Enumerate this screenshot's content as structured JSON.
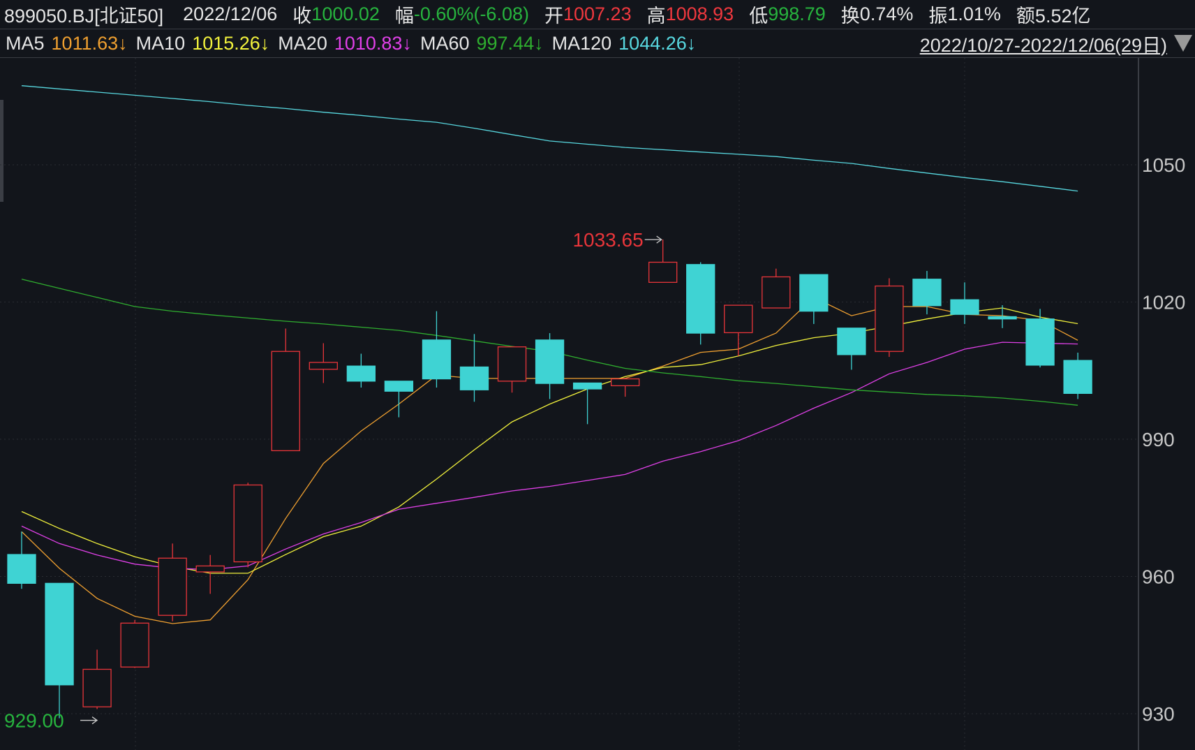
{
  "header": {
    "symbol": "899050.BJ[北证50]",
    "date": "2022/12/06",
    "close_label": "收",
    "close": "1000.02",
    "change_label": "幅",
    "change": "-0.60%(-6.08)",
    "open_label": "开",
    "open": "1007.23",
    "high_label": "高",
    "high": "1008.93",
    "low_label": "低",
    "low": "998.79",
    "turnover_label": "换",
    "turnover": "0.74%",
    "amplitude_label": "振",
    "amplitude": "1.01%",
    "amount_label": "额",
    "amount": "5.52亿"
  },
  "ma_bar": {
    "ma5_label": "MA5",
    "ma5": "1011.63↓",
    "ma10_label": "MA10",
    "ma10": "1015.26↓",
    "ma20_label": "MA20",
    "ma20": "1010.83↓",
    "ma60_label": "MA60",
    "ma60": "997.44↓",
    "ma120_label": "MA120",
    "ma120": "1044.26↓",
    "range": "2022/10/27-2022/12/06(29日)"
  },
  "colors": {
    "up": "#e8353a",
    "down": "#3fd3d3",
    "ma5": "#f0a030",
    "ma10": "#f2f23c",
    "ma20": "#e040e8",
    "ma60": "#2fae2f",
    "ma120": "#58d8e0",
    "axis": "#c8c8c8"
  },
  "chart_data": {
    "type": "candlestick",
    "ylim": [
      925,
      1080
    ],
    "yticks": [
      "1050",
      "1020",
      "990",
      "960",
      "930"
    ],
    "ytick_values": [
      1050,
      1020,
      990,
      960,
      930
    ],
    "annotations": {
      "max_label": "1033.65",
      "max_index": 17,
      "min_label": "929.00",
      "min_index": 1
    },
    "ohlc": [
      [
        964.8,
        969.8,
        957.3,
        958.5
      ],
      [
        958.5,
        958.5,
        929.0,
        936.3
      ],
      [
        931.5,
        944.0,
        931.0,
        939.7
      ],
      [
        940.2,
        950.5,
        940.0,
        949.8
      ],
      [
        951.5,
        967.2,
        950.2,
        964.0
      ],
      [
        961.0,
        964.7,
        956.2,
        962.3
      ],
      [
        963.2,
        980.5,
        962.0,
        980.0
      ],
      [
        987.5,
        1014.2,
        987.5,
        1009.2
      ],
      [
        1005.3,
        1011.0,
        1002.3,
        1006.8
      ],
      [
        1006.0,
        1008.7,
        1001.3,
        1002.7
      ],
      [
        1002.7,
        1002.7,
        994.8,
        1000.5
      ],
      [
        1011.7,
        1018.0,
        1001.3,
        1003.2
      ],
      [
        1005.8,
        1013.0,
        998.2,
        1000.8
      ],
      [
        1002.7,
        1010.2,
        1000.2,
        1010.2
      ],
      [
        1011.7,
        1013.2,
        998.8,
        1002.2
      ],
      [
        1002.3,
        1002.3,
        993.3,
        1001.0
      ],
      [
        1001.7,
        1003.2,
        999.3,
        1003.2
      ],
      [
        1024.3,
        1033.65,
        1024.3,
        1028.7
      ],
      [
        1028.2,
        1028.7,
        1010.7,
        1013.2
      ],
      [
        1013.3,
        1019.3,
        1008.2,
        1019.3
      ],
      [
        1018.7,
        1027.3,
        1018.7,
        1025.5
      ],
      [
        1026.0,
        1026.0,
        1015.2,
        1018.0
      ],
      [
        1014.3,
        1014.3,
        1005.2,
        1008.5
      ],
      [
        1009.2,
        1025.2,
        1008.0,
        1023.5
      ],
      [
        1025.0,
        1026.8,
        1017.3,
        1019.2
      ],
      [
        1020.5,
        1024.3,
        1015.2,
        1017.3
      ],
      [
        1016.8,
        1019.3,
        1014.3,
        1016.3
      ],
      [
        1016.3,
        1018.5,
        1005.7,
        1006.2
      ],
      [
        1007.23,
        1008.93,
        998.79,
        1000.02
      ]
    ],
    "series": [
      {
        "name": "MA5",
        "values": [
          969.8,
          961.8,
          955.2,
          951.3,
          949.7,
          950.5,
          959.3,
          972.7,
          984.7,
          991.8,
          997.7,
          1004,
          1003.3,
          1003.3,
          1003.3,
          1003.3,
          1003.3,
          1006,
          1009,
          1009.7,
          1013.2,
          1021,
          1017,
          1019,
          1019,
          1017.3,
          1017,
          1016,
          1011.63
        ]
      },
      {
        "name": "MA10",
        "values": [
          974.2,
          970.5,
          967.2,
          964.3,
          962.2,
          960.7,
          960.7,
          964.8,
          968.7,
          971,
          975.2,
          981.3,
          987.7,
          993.8,
          997.7,
          1001,
          1003.7,
          1005.7,
          1006.3,
          1008.2,
          1010.5,
          1012.2,
          1013.2,
          1014.7,
          1016.3,
          1017.7,
          1018.7,
          1016.7,
          1015.26
        ]
      },
      {
        "name": "MA20",
        "values": [
          971,
          967.2,
          964.7,
          962.7,
          961.8,
          961.5,
          962.3,
          966,
          969.3,
          971.8,
          974.7,
          976,
          977.3,
          978.7,
          979.7,
          981,
          982.3,
          985.2,
          987.3,
          989.7,
          993,
          996.8,
          1000.2,
          1004.3,
          1006.8,
          1009.7,
          1011.2,
          1011,
          1010.83
        ]
      },
      {
        "name": "MA60",
        "values": [
          1025,
          1023,
          1021,
          1019,
          1018,
          1017.2,
          1016.5,
          1015.8,
          1015.2,
          1014.5,
          1013.8,
          1012.7,
          1011.5,
          1010.3,
          1009.2,
          1007.3,
          1005.5,
          1004.5,
          1003.7,
          1002.8,
          1002.2,
          1001.5,
          1000.8,
          1000.3,
          999.8,
          999.5,
          999,
          998.3,
          997.44
        ]
      },
      {
        "name": "MA120",
        "values": [
          1067.3,
          1066.6,
          1065.9,
          1065.2,
          1064.5,
          1063.8,
          1063,
          1062.3,
          1061.5,
          1060.8,
          1060,
          1059.3,
          1058,
          1056.6,
          1055.2,
          1054.5,
          1053.8,
          1053.3,
          1052.8,
          1052.3,
          1051.8,
          1051,
          1050.3,
          1049.2,
          1048.2,
          1047.2,
          1046.3,
          1045.3,
          1044.26
        ]
      }
    ]
  }
}
